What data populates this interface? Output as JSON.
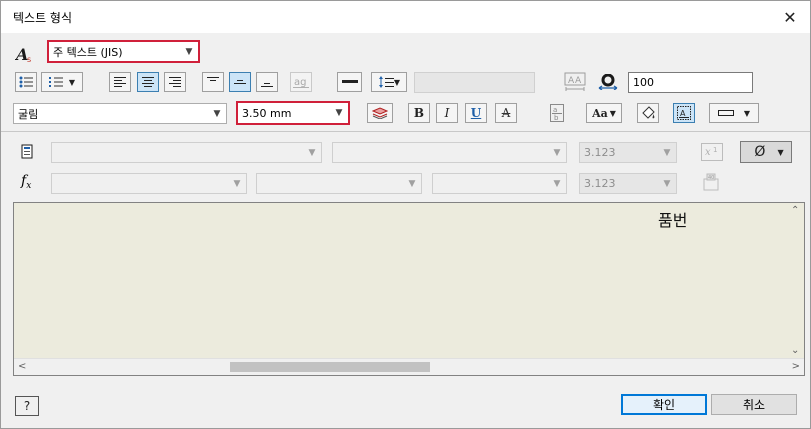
{
  "window": {
    "title": "텍스트 형식",
    "close_glyph": "✕"
  },
  "row1": {
    "text_style": "주 텍스트 (JIS)"
  },
  "row2": {
    "line_spacing_value": "100"
  },
  "row3": {
    "font": "굴림",
    "font_size": "3.50 mm",
    "bold": "B",
    "italic": "I",
    "underline": "U",
    "strike": "A",
    "stack_label": "Aa",
    "symbol_label": "Ø"
  },
  "row4": {
    "precision": "3.123",
    "symbol": "Ø"
  },
  "row5": {
    "precision": "3.123",
    "fx_label": "fx"
  },
  "editor": {
    "content": "품번"
  },
  "footer": {
    "ok_label": "확인",
    "cancel_label": "취소",
    "help_glyph": "?"
  },
  "colors": {
    "highlight_border": "#d0203a",
    "editor_bg": "#ecebdd",
    "pressed": "#cce4f7"
  }
}
